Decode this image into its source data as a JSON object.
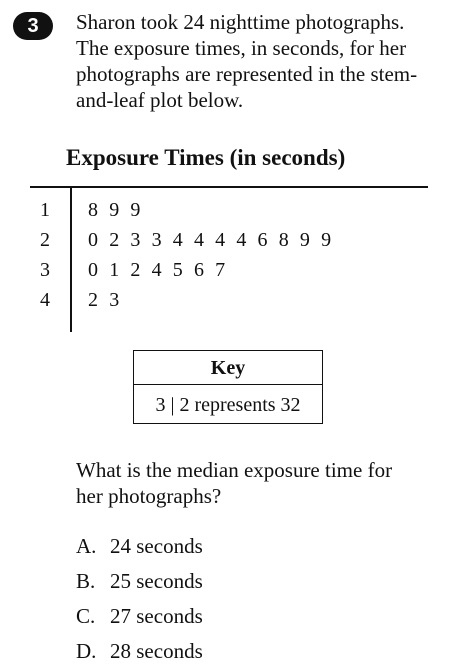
{
  "question_number": "3",
  "prompt": "Sharon took 24 nighttime photographs.\nThe exposure times, in seconds, for her\nphotographs are represented in the stem-\nand-leaf plot below.",
  "plot": {
    "title": "Exposure Times (in seconds)",
    "rows": [
      {
        "stem": "1",
        "leaves": [
          "8",
          "9",
          "9"
        ]
      },
      {
        "stem": "2",
        "leaves": [
          "0",
          "2",
          "3",
          "3",
          "4",
          "4",
          "4",
          "4",
          "6",
          "8",
          "9",
          "9"
        ]
      },
      {
        "stem": "3",
        "leaves": [
          "0",
          "1",
          "2",
          "4",
          "5",
          "6",
          "7"
        ]
      },
      {
        "stem": "4",
        "leaves": [
          "2",
          "3"
        ]
      }
    ]
  },
  "key": {
    "title": "Key",
    "text": "3 | 2 represents 32"
  },
  "question": "What is the median exposure time for\nher photographs?",
  "choices": [
    {
      "letter": "A.",
      "text": "24 seconds"
    },
    {
      "letter": "B.",
      "text": "25 seconds"
    },
    {
      "letter": "C.",
      "text": "27 seconds"
    },
    {
      "letter": "D.",
      "text": "28 seconds"
    }
  ]
}
